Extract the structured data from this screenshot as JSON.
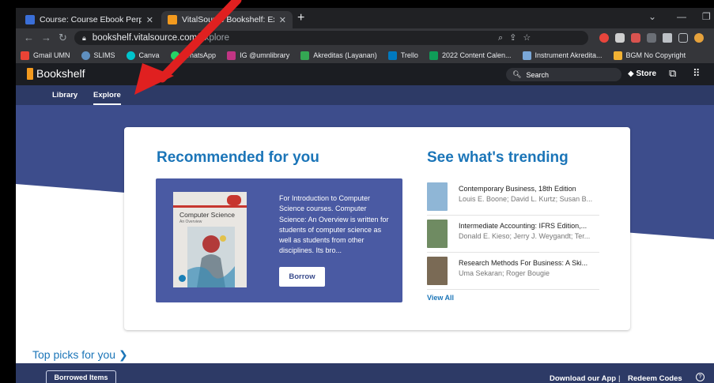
{
  "browser": {
    "tabs": [
      {
        "title": "Course: Course Ebook Perpus",
        "active": false
      },
      {
        "title": "VitalSource Bookshelf: Explore",
        "active": true
      }
    ],
    "url_host": "bookshelf.vitalsource.com",
    "url_path": "/explore",
    "bookmarks": [
      "Gmail UMN",
      "SLIMS",
      "Canva",
      "WhatsApp",
      "IG @umnlibrary",
      "Akreditas (Layanan)",
      "Trello",
      "2022 Content Calen...",
      "Instrument Akredita...",
      "BGM No Copyright"
    ]
  },
  "header": {
    "brand": "Bookshelf",
    "search_placeholder": "Search",
    "store_label": "Store"
  },
  "subnav": {
    "tabs": [
      "Library",
      "Explore"
    ],
    "active": "Explore"
  },
  "recommended": {
    "heading": "Recommended for you",
    "book": {
      "cover_title": "Computer Science",
      "cover_subtitle": "An Overview",
      "blurb": "For Introduction to Computer Science courses. Computer Science: An Overview is written for students of computer science as well as students from other disciplines. Its bro..."
    },
    "button_label": "Borrow"
  },
  "trending": {
    "heading": "See what's trending",
    "items": [
      {
        "title": "Contemporary Business, 18th Edition",
        "authors": "Louis E. Boone; David L. Kurtz; Susan B...",
        "thumb_color": "#8fb6d6"
      },
      {
        "title": "Intermediate Accounting: IFRS Edition,...",
        "authors": "Donald E. Kieso; Jerry J. Weygandt; Ter...",
        "thumb_color": "#6f8b62"
      },
      {
        "title": "Research Methods For Business: A Ski...",
        "authors": "Uma Sekaran; Roger Bougie",
        "thumb_color": "#7a6a55"
      }
    ],
    "view_all": "View All"
  },
  "top_picks": "Top picks for you ❯",
  "footer": {
    "borrowed_label": "Borrowed Items",
    "download_label": "Download our App",
    "separator": "|",
    "redeem_label": "Redeem Codes"
  },
  "colors": {
    "brand_blue": "#1b75b8",
    "nav_navy": "#2d3a66",
    "feature_bg": "#4a5aa3",
    "annotation_red": "#e02020"
  }
}
